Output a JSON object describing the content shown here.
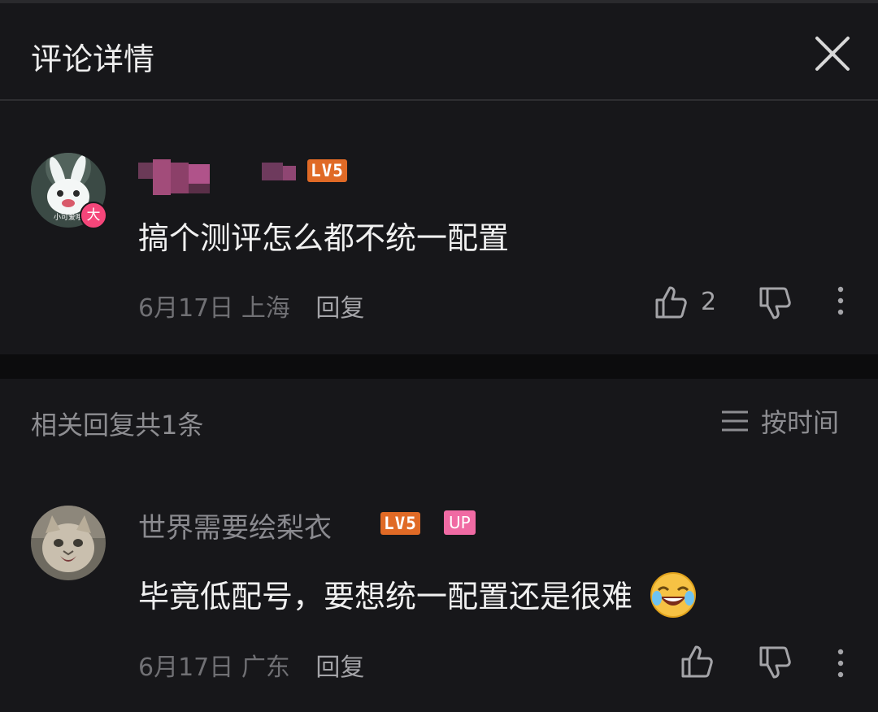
{
  "header": {
    "title": "评论详情"
  },
  "main_comment": {
    "user_level": "LV5",
    "avatar_badge": "大",
    "avatar_caption": "小可爱哦",
    "text": "搞个测评怎么都不统一配置",
    "date": "6月17日",
    "location": "上海",
    "reply_label": "回复",
    "like_count": "2"
  },
  "replies": {
    "count_label": "相关回复共1条",
    "sort_label": "按时间"
  },
  "reply": {
    "username": "世界需要绘梨衣",
    "user_level": "LV5",
    "up_badge": "UP",
    "text": "毕竟低配号，要想统一配置还是很难",
    "emoji": "laughing-tears-emoji",
    "date": "6月17日",
    "location": "广东",
    "reply_label": "回复"
  },
  "colors": {
    "background": "#17171a",
    "level_badge": "#e06a26",
    "up_badge": "#f06aa3",
    "avatar_badge": "#f5467a"
  }
}
